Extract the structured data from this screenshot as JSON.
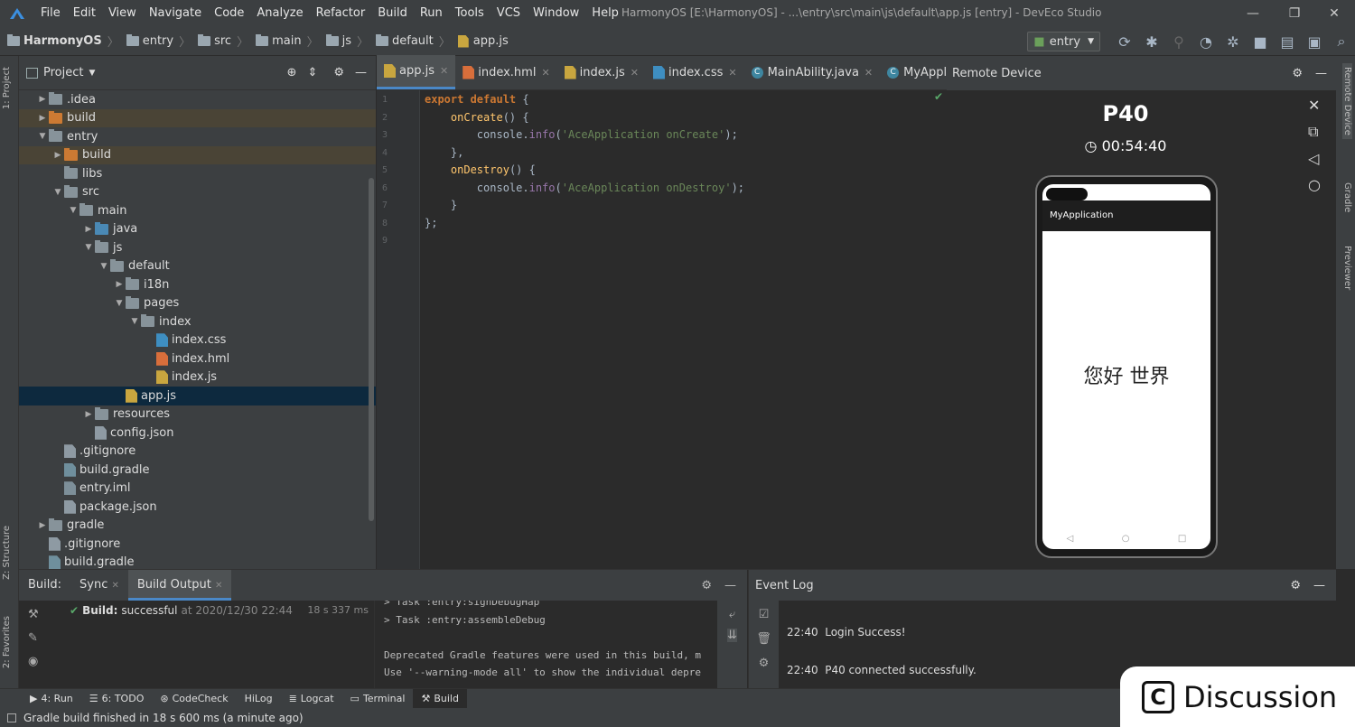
{
  "menu": [
    "File",
    "Edit",
    "View",
    "Navigate",
    "Code",
    "Analyze",
    "Refactor",
    "Build",
    "Run",
    "Tools",
    "VCS",
    "Window",
    "Help"
  ],
  "window_title": "HarmonyOS [E:\\HarmonyOS] - ...\\entry\\src\\main\\js\\default\\app.js [entry] - DevEco Studio",
  "breadcrumb": [
    "HarmonyOS",
    "entry",
    "src",
    "main",
    "js",
    "default",
    "app.js"
  ],
  "run_config": "entry",
  "project_panel": {
    "title": "Project",
    "tree": [
      {
        "label": ".idea",
        "indent": 1,
        "arrow": "▶",
        "icon": "folder-gray"
      },
      {
        "label": "build",
        "indent": 1,
        "arrow": "▶",
        "icon": "folder-orange",
        "state": "excluded"
      },
      {
        "label": "entry",
        "indent": 1,
        "arrow": "▼",
        "icon": "folder-gray"
      },
      {
        "label": "build",
        "indent": 2,
        "arrow": "▶",
        "icon": "folder-orange",
        "state": "excluded"
      },
      {
        "label": "libs",
        "indent": 2,
        "arrow": "",
        "icon": "folder-gray"
      },
      {
        "label": "src",
        "indent": 2,
        "arrow": "▼",
        "icon": "folder-gray"
      },
      {
        "label": "main",
        "indent": 3,
        "arrow": "▼",
        "icon": "folder-gray"
      },
      {
        "label": "java",
        "indent": 4,
        "arrow": "▶",
        "icon": "folder-blue"
      },
      {
        "label": "js",
        "indent": 4,
        "arrow": "▼",
        "icon": "folder-gray"
      },
      {
        "label": "default",
        "indent": 5,
        "arrow": "▼",
        "icon": "folder-gray"
      },
      {
        "label": "i18n",
        "indent": 6,
        "arrow": "▶",
        "icon": "folder-gray"
      },
      {
        "label": "pages",
        "indent": 6,
        "arrow": "▼",
        "icon": "folder-gray"
      },
      {
        "label": "index",
        "indent": 7,
        "arrow": "▼",
        "icon": "folder-gray"
      },
      {
        "label": "index.css",
        "indent": 8,
        "arrow": "",
        "icon": "file-css"
      },
      {
        "label": "index.hml",
        "indent": 8,
        "arrow": "",
        "icon": "file-html"
      },
      {
        "label": "index.js",
        "indent": 8,
        "arrow": "",
        "icon": "file-js"
      },
      {
        "label": "app.js",
        "indent": 6,
        "arrow": "",
        "icon": "file-js",
        "state": "selected"
      },
      {
        "label": "resources",
        "indent": 4,
        "arrow": "▶",
        "icon": "folder-gray"
      },
      {
        "label": "config.json",
        "indent": 4,
        "arrow": "",
        "icon": "file-json"
      },
      {
        "label": ".gitignore",
        "indent": 2,
        "arrow": "",
        "icon": "file-git"
      },
      {
        "label": "build.gradle",
        "indent": 2,
        "arrow": "",
        "icon": "file-gradle"
      },
      {
        "label": "entry.iml",
        "indent": 2,
        "arrow": "",
        "icon": "file-iml"
      },
      {
        "label": "package.json",
        "indent": 2,
        "arrow": "",
        "icon": "file-json"
      },
      {
        "label": "gradle",
        "indent": 1,
        "arrow": "▶",
        "icon": "folder-gray"
      },
      {
        "label": ".gitignore",
        "indent": 1,
        "arrow": "",
        "icon": "file-git"
      },
      {
        "label": "build.gradle",
        "indent": 1,
        "arrow": "",
        "icon": "file-gradle"
      }
    ]
  },
  "editor_tabs": [
    {
      "label": "app.js",
      "icon": "file-js",
      "active": true
    },
    {
      "label": "index.hml",
      "icon": "file-html"
    },
    {
      "label": "index.js",
      "icon": "file-js"
    },
    {
      "label": "index.css",
      "icon": "file-css"
    },
    {
      "label": "MainAbility.java",
      "icon": "java-class"
    },
    {
      "label": "MyAppl",
      "icon": "java-class"
    }
  ],
  "code_lines": [
    [
      {
        "t": "export default ",
        "c": "kw"
      },
      {
        "t": "{",
        "c": "plain"
      }
    ],
    [
      {
        "t": "    ",
        "c": "plain"
      },
      {
        "t": "onCreate",
        "c": "fn"
      },
      {
        "t": "() {",
        "c": "plain"
      }
    ],
    [
      {
        "t": "        console.",
        "c": "plain"
      },
      {
        "t": "info",
        "c": "mth"
      },
      {
        "t": "(",
        "c": "plain"
      },
      {
        "t": "'AceApplication onCreate'",
        "c": "str"
      },
      {
        "t": ");",
        "c": "plain"
      }
    ],
    [
      {
        "t": "    },",
        "c": "plain"
      }
    ],
    [
      {
        "t": "    ",
        "c": "plain"
      },
      {
        "t": "onDestroy",
        "c": "fn"
      },
      {
        "t": "() {",
        "c": "plain"
      }
    ],
    [
      {
        "t": "        console.",
        "c": "plain"
      },
      {
        "t": "info",
        "c": "mth"
      },
      {
        "t": "(",
        "c": "plain"
      },
      {
        "t": "'AceApplication onDestroy'",
        "c": "str"
      },
      {
        "t": ");",
        "c": "plain"
      }
    ],
    [
      {
        "t": "    }",
        "c": "plain"
      }
    ],
    [
      {
        "t": "};",
        "c": "plain"
      }
    ],
    [
      {
        "t": "",
        "c": "plain"
      }
    ]
  ],
  "remote_device": {
    "title": "Remote Device",
    "device_name": "P40",
    "timer": "00:54:40",
    "app_title": "MyApplication",
    "screen_text": "您好 世界"
  },
  "right_strip": [
    "Remote Device",
    "Gradle",
    "Previewer"
  ],
  "left_strip": [
    "1: Project",
    "Z: Structure",
    "2: Favorites"
  ],
  "build_panel": {
    "label": "Build:",
    "tabs": [
      "Sync",
      "Build Output"
    ],
    "status_label": "Build:",
    "status_value": "successful",
    "status_time": "at 2020/12/30 22:44",
    "duration": "18 s 337 ms",
    "output": [
      "> Task :entry:signDebugHap",
      "> Task :entry:assembleDebug",
      "",
      "Deprecated Gradle features were used in this build, m",
      "Use '--warning-mode all' to show the individual depre"
    ]
  },
  "event_log": {
    "title": "Event Log",
    "entries": [
      {
        "time": "22:40",
        "msg": "Login Success!"
      },
      {
        "time": "22:40",
        "msg": "P40 connected successfully."
      }
    ]
  },
  "tool_windows": [
    "4: Run",
    "6: TODO",
    "CodeCheck",
    "HiLog",
    "Logcat",
    "Terminal",
    "Build"
  ],
  "status_bar": "Gradle build finished in 18 s 600 ms (a minute ago)",
  "discussion_label": "Discussion"
}
